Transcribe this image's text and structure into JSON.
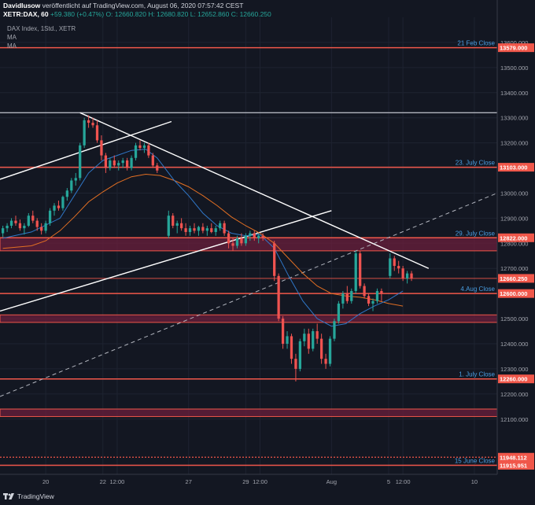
{
  "header": {
    "author": "DavidIusow",
    "published": " veröffentlicht auf TradingView.com, August 06, 2020 07:57:42 CEST",
    "symbol": "XETR:DAX, 60",
    "change": "+59.380 (+0.47%)",
    "ohlc": "O: 12660.820  H: 12680.820  L: 12652.860  C: 12660.250"
  },
  "indicators": [
    "DAX Index, 1Std., XETR",
    "MA",
    "MA"
  ],
  "footer": {
    "brand": "TradingView"
  },
  "colors": {
    "background": "#131722",
    "up": "#26a69a",
    "down": "#ef5350",
    "level": "#f0574a",
    "label": "#4a9fe3",
    "ma_fast": "#2f77c8",
    "ma_slow": "#e26f23",
    "trend": "#ffffff",
    "zone": "#6b1f3c"
  },
  "chart_data": {
    "type": "candlestick",
    "y_ticks": [
      12100,
      12200,
      12300,
      12400,
      12500,
      12600,
      12700,
      12800,
      12900,
      13000,
      13100,
      13200,
      13300,
      13400,
      13500,
      13600
    ],
    "y_tick_labels": [
      "12100.000",
      "12200.000",
      "12300.000",
      "12400.000",
      "12500.000",
      "12600.000",
      "12700.000",
      "12800.000",
      "12900.000",
      "13000.000",
      "13100.000",
      "13200.000",
      "13300.000",
      "13400.000",
      "13500.000",
      "13600.000"
    ],
    "ylim": [
      11880,
      13700
    ],
    "x_ticks": [
      {
        "label": "20",
        "t": 1.0
      },
      {
        "label": "22",
        "t": 3.0
      },
      {
        "label": "12:00",
        "t": 3.5
      },
      {
        "label": "27",
        "t": 6.0
      },
      {
        "label": "29",
        "t": 8.0
      },
      {
        "label": "12:00",
        "t": 8.5
      },
      {
        "label": "Aug",
        "t": 11.0
      },
      {
        "label": "5",
        "t": 13.0
      },
      {
        "label": "12:00",
        "t": 13.5
      },
      {
        "label": "10",
        "t": 16.0
      }
    ],
    "xlim": [
      -0.6,
      16.8
    ],
    "levels": [
      {
        "label": "21 Feb Close",
        "value": 13579.0,
        "price": "13579.000",
        "color": "#f0574a",
        "style": "solid"
      },
      {
        "label": "23. July Close",
        "value": 13103.0,
        "price": "13103.000",
        "color": "#f0574a",
        "style": "solid"
      },
      {
        "label": "29. July Close",
        "value": 12822.0,
        "price": "12822.000",
        "color": "#f0574a",
        "style": "solid"
      },
      {
        "label": "4.Aug Close",
        "value": 12600.0,
        "price": "12600.000",
        "color": "#f0574a",
        "style": "solid"
      },
      {
        "label": "1. July Close",
        "value": 12260.0,
        "price": "12260.000",
        "color": "#f0574a",
        "style": "solid"
      },
      {
        "label": "15 June Close",
        "value": 11915.951,
        "price": "11915.951",
        "color": "#f0574a",
        "style": "solid"
      }
    ],
    "extra_lines": [
      {
        "value": 13320,
        "color": "#b2b5be",
        "style": "solid"
      },
      {
        "value": 11948.112,
        "price": "11948.112",
        "color": "#f0574a",
        "style": "dotted"
      },
      {
        "value": 12660.25,
        "price": "12660.250",
        "color": "#f0574a",
        "style": "thin"
      }
    ],
    "zones": [
      {
        "from": 12770,
        "to": 12822
      },
      {
        "from": 12485,
        "to": 12515
      },
      {
        "from": 12110,
        "to": 12140
      }
    ],
    "trendlines": [
      {
        "t1": -0.6,
        "v1": 13055,
        "t2": 5.4,
        "v2": 13285,
        "color": "#ffffff",
        "dash": false
      },
      {
        "t1": -0.6,
        "v1": 12530,
        "t2": 11.0,
        "v2": 12930,
        "color": "#ffffff",
        "dash": false
      },
      {
        "t1": 2.2,
        "v1": 13320,
        "t2": 14.4,
        "v2": 12700,
        "color": "#ffffff",
        "dash": false
      },
      {
        "t1": -0.6,
        "v1": 12190,
        "t2": 16.8,
        "v2": 13000,
        "color": "#b2b5be",
        "dash": true
      }
    ],
    "candles": [
      [
        -0.5,
        12840,
        12870,
        12825,
        12860
      ],
      [
        -0.35,
        12860,
        12880,
        12845,
        12870
      ],
      [
        -0.2,
        12870,
        12900,
        12860,
        12890
      ],
      [
        -0.05,
        12890,
        12910,
        12870,
        12880
      ],
      [
        0.1,
        12880,
        12895,
        12850,
        12860
      ],
      [
        0.25,
        12860,
        12880,
        12835,
        12870
      ],
      [
        0.4,
        12870,
        12920,
        12865,
        12910
      ],
      [
        0.55,
        12910,
        12930,
        12880,
        12890
      ],
      [
        0.7,
        12890,
        12900,
        12850,
        12865
      ],
      [
        0.85,
        12865,
        12880,
        12835,
        12850
      ],
      [
        1.0,
        12850,
        12890,
        12840,
        12880
      ],
      [
        1.15,
        12880,
        12940,
        12870,
        12930
      ],
      [
        1.3,
        12930,
        12960,
        12910,
        12950
      ],
      [
        1.45,
        12950,
        12970,
        12930,
        12940
      ],
      [
        1.6,
        12940,
        12990,
        12930,
        12985
      ],
      [
        1.75,
        12985,
        13020,
        12970,
        13010
      ],
      [
        1.9,
        13010,
        13060,
        13000,
        13050
      ],
      [
        2.05,
        13050,
        13080,
        13030,
        13060
      ],
      [
        2.2,
        13060,
        13200,
        13050,
        13190
      ],
      [
        2.35,
        13190,
        13300,
        13180,
        13290
      ],
      [
        2.5,
        13290,
        13310,
        13260,
        13280
      ],
      [
        2.65,
        13280,
        13300,
        13260,
        13270
      ],
      [
        2.8,
        13270,
        13290,
        13200,
        13210
      ],
      [
        2.95,
        13210,
        13230,
        13130,
        13150
      ],
      [
        3.1,
        13150,
        13160,
        13080,
        13100
      ],
      [
        3.25,
        13100,
        13140,
        13090,
        13130
      ],
      [
        3.4,
        13130,
        13150,
        13100,
        13110
      ],
      [
        3.55,
        13110,
        13130,
        13090,
        13120
      ],
      [
        3.7,
        13120,
        13140,
        13100,
        13130
      ],
      [
        3.85,
        13130,
        13140,
        13090,
        13100
      ],
      [
        4.0,
        13100,
        13150,
        13090,
        13140
      ],
      [
        4.15,
        13140,
        13200,
        13130,
        13190
      ],
      [
        4.3,
        13190,
        13210,
        13170,
        13180
      ],
      [
        4.45,
        13180,
        13200,
        13160,
        13190
      ],
      [
        4.6,
        13190,
        13200,
        13140,
        13150
      ],
      [
        4.75,
        13150,
        13160,
        13100,
        13110
      ],
      [
        4.9,
        13110,
        13120,
        13080,
        13090
      ],
      [
        5.3,
        12830,
        12930,
        12820,
        12910
      ],
      [
        5.45,
        12910,
        12920,
        12860,
        12870
      ],
      [
        5.6,
        12870,
        12890,
        12840,
        12880
      ],
      [
        5.75,
        12880,
        12900,
        12850,
        12860
      ],
      [
        5.9,
        12860,
        12880,
        12830,
        12845
      ],
      [
        6.05,
        12845,
        12870,
        12830,
        12860
      ],
      [
        6.2,
        12860,
        12880,
        12840,
        12850
      ],
      [
        6.35,
        12850,
        12870,
        12830,
        12865
      ],
      [
        6.5,
        12865,
        12880,
        12840,
        12850
      ],
      [
        6.65,
        12850,
        12870,
        12830,
        12860
      ],
      [
        6.8,
        12860,
        12880,
        12840,
        12845
      ],
      [
        6.95,
        12845,
        12870,
        12830,
        12860
      ],
      [
        7.1,
        12860,
        12890,
        12850,
        12880
      ],
      [
        7.25,
        12880,
        12890,
        12830,
        12840
      ],
      [
        7.4,
        12840,
        12850,
        12780,
        12800
      ],
      [
        7.55,
        12800,
        12820,
        12770,
        12790
      ],
      [
        7.7,
        12790,
        12830,
        12780,
        12820
      ],
      [
        7.85,
        12820,
        12840,
        12790,
        12800
      ],
      [
        8.0,
        12800,
        12840,
        12790,
        12830
      ],
      [
        8.15,
        12830,
        12850,
        12810,
        12840
      ],
      [
        8.3,
        12840,
        12850,
        12810,
        12820
      ],
      [
        8.45,
        12820,
        12840,
        12800,
        12830
      ],
      [
        8.6,
        12830,
        12840,
        12810,
        12820
      ],
      [
        9.0,
        12800,
        12810,
        12650,
        12670
      ],
      [
        9.15,
        12670,
        12680,
        12490,
        12500
      ],
      [
        9.3,
        12500,
        12510,
        12380,
        12400
      ],
      [
        9.45,
        12400,
        12450,
        12380,
        12430
      ],
      [
        9.6,
        12430,
        12440,
        12320,
        12340
      ],
      [
        9.75,
        12340,
        12360,
        12250,
        12300
      ],
      [
        9.9,
        12300,
        12420,
        12290,
        12410
      ],
      [
        10.05,
        12410,
        12460,
        12390,
        12440
      ],
      [
        10.2,
        12440,
        12460,
        12360,
        12380
      ],
      [
        10.35,
        12380,
        12460,
        12370,
        12450
      ],
      [
        10.5,
        12450,
        12480,
        12400,
        12420
      ],
      [
        10.65,
        12420,
        12440,
        12320,
        12340
      ],
      [
        10.8,
        12340,
        12360,
        12300,
        12320
      ],
      [
        10.95,
        12320,
        12430,
        12310,
        12420
      ],
      [
        11.1,
        12420,
        12500,
        12410,
        12490
      ],
      [
        11.25,
        12490,
        12570,
        12480,
        12560
      ],
      [
        11.4,
        12560,
        12610,
        12540,
        12600
      ],
      [
        11.55,
        12600,
        12630,
        12560,
        12570
      ],
      [
        11.7,
        12570,
        12620,
        12560,
        12610
      ],
      [
        11.85,
        12610,
        12770,
        12600,
        12760
      ],
      [
        12.0,
        12760,
        12770,
        12620,
        12630
      ],
      [
        12.15,
        12630,
        12640,
        12580,
        12590
      ],
      [
        12.3,
        12590,
        12600,
        12550,
        12560
      ],
      [
        12.45,
        12560,
        12580,
        12530,
        12570
      ],
      [
        12.6,
        12570,
        12620,
        12560,
        12610
      ],
      [
        12.75,
        12610,
        12620,
        12570,
        12600
      ],
      [
        13.05,
        12670,
        12760,
        12660,
        12740
      ],
      [
        13.2,
        12740,
        12750,
        12690,
        12710
      ],
      [
        13.35,
        12710,
        12730,
        12680,
        12700
      ],
      [
        13.5,
        12700,
        12710,
        12650,
        12660
      ],
      [
        13.65,
        12660,
        12690,
        12640,
        12680
      ],
      [
        13.8,
        12680,
        12690,
        12650,
        12660
      ]
    ],
    "ma_fast": [
      [
        -0.5,
        12820
      ],
      [
        0.5,
        12845
      ],
      [
        1.5,
        12900
      ],
      [
        2.0,
        12990
      ],
      [
        2.5,
        13080
      ],
      [
        3.0,
        13130
      ],
      [
        3.5,
        13150
      ],
      [
        4.0,
        13170
      ],
      [
        4.5,
        13175
      ],
      [
        4.9,
        13140
      ],
      [
        5.5,
        13050
      ],
      [
        6.0,
        12990
      ],
      [
        6.5,
        12920
      ],
      [
        7.0,
        12870
      ],
      [
        7.5,
        12840
      ],
      [
        8.0,
        12830
      ],
      [
        8.5,
        12835
      ],
      [
        9.0,
        12780
      ],
      [
        9.5,
        12670
      ],
      [
        10.0,
        12570
      ],
      [
        10.5,
        12500
      ],
      [
        11.0,
        12470
      ],
      [
        11.5,
        12480
      ],
      [
        12.0,
        12520
      ],
      [
        12.5,
        12550
      ],
      [
        13.0,
        12575
      ],
      [
        13.5,
        12610
      ]
    ],
    "ma_slow": [
      [
        -0.5,
        12780
      ],
      [
        0.5,
        12790
      ],
      [
        1.0,
        12810
      ],
      [
        1.5,
        12850
      ],
      [
        2.0,
        12905
      ],
      [
        2.5,
        12965
      ],
      [
        3.0,
        13005
      ],
      [
        3.5,
        13040
      ],
      [
        4.0,
        13065
      ],
      [
        4.5,
        13075
      ],
      [
        5.0,
        13070
      ],
      [
        5.5,
        13050
      ],
      [
        6.0,
        13025
      ],
      [
        6.5,
        12990
      ],
      [
        7.0,
        12950
      ],
      [
        7.5,
        12905
      ],
      [
        8.0,
        12870
      ],
      [
        8.5,
        12840
      ],
      [
        9.0,
        12800
      ],
      [
        9.5,
        12740
      ],
      [
        10.0,
        12680
      ],
      [
        10.5,
        12630
      ],
      [
        11.0,
        12600
      ],
      [
        11.5,
        12590
      ],
      [
        12.0,
        12585
      ],
      [
        12.5,
        12575
      ],
      [
        13.0,
        12560
      ],
      [
        13.5,
        12550
      ]
    ]
  }
}
